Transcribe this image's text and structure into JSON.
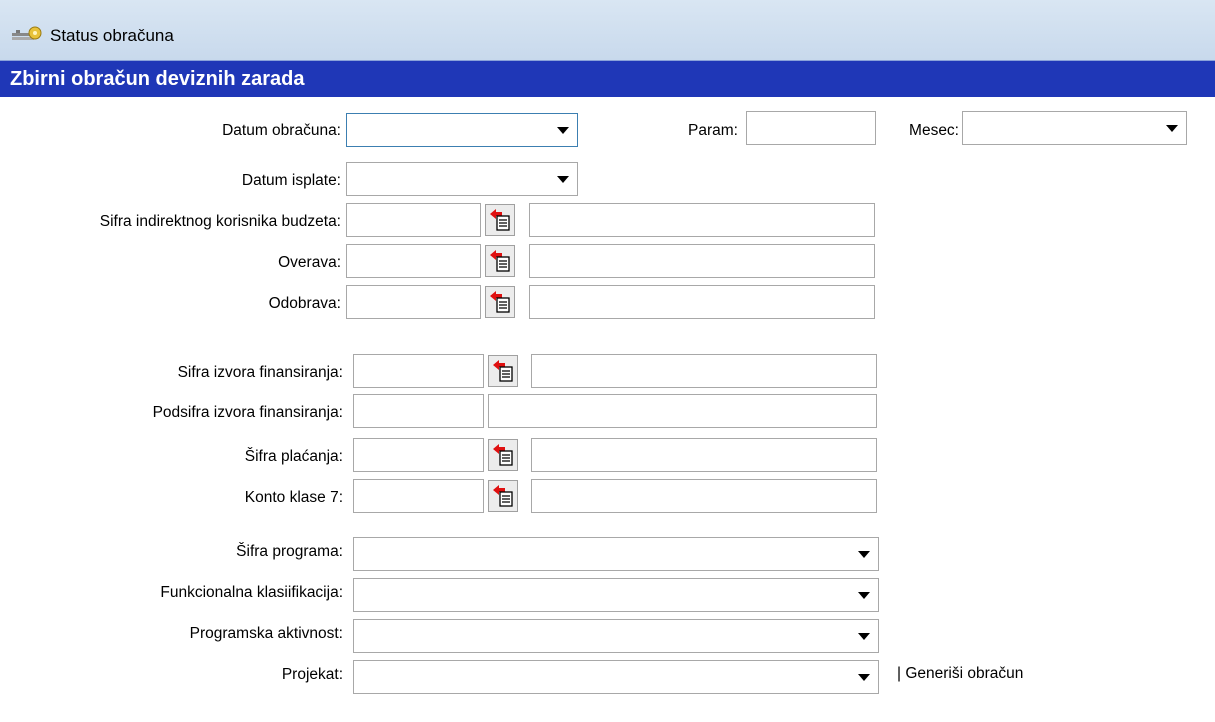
{
  "window": {
    "title": "Status obračuna"
  },
  "header": {
    "title": "Zbirni obračun deviznih zarada"
  },
  "fields": {
    "datum_obracuna": {
      "label": "Datum obračuna:",
      "value": ""
    },
    "param": {
      "label": "Param:",
      "value": ""
    },
    "mesec": {
      "label": "Mesec:",
      "value": ""
    },
    "datum_isplate": {
      "label": "Datum isplate:",
      "value": ""
    },
    "sifra_korisnika": {
      "label": "Sifra indirektnog korisnika budzeta:",
      "code": "",
      "name": ""
    },
    "overava": {
      "label": "Overava:",
      "code": "",
      "name": ""
    },
    "odobrava": {
      "label": "Odobrava:",
      "code": "",
      "name": ""
    },
    "sifra_izvora": {
      "label": "Sifra izvora finansiranja:",
      "code": "",
      "name": ""
    },
    "podsifra_izvora": {
      "label": "Podsifra izvora finansiranja:",
      "code": "",
      "name": ""
    },
    "sifra_placanja": {
      "label": "Šifra plaćanja:",
      "code": "",
      "name": ""
    },
    "konto_klase": {
      "label": "Konto klase 7:",
      "code": "",
      "name": ""
    },
    "sifra_programa": {
      "label": "Šifra programa:",
      "value": ""
    },
    "funkcionalna": {
      "label": "Funkcionalna  klasiifikacija:",
      "value": ""
    },
    "programska": {
      "label": "Programska aktivnost:",
      "value": ""
    },
    "projekat": {
      "label": "Projekat:",
      "value": ""
    }
  },
  "actions": {
    "generisi": "| Generiši obračun"
  },
  "icons": {
    "title": "keys-icon",
    "lookup": "lookup-arrow-document-icon",
    "dropdown": "chevron-down-icon"
  },
  "colors": {
    "header_bg": "#1f37b7",
    "titlebar_bg": "#d3e2f1",
    "lookup_arrow": "#e01010"
  }
}
